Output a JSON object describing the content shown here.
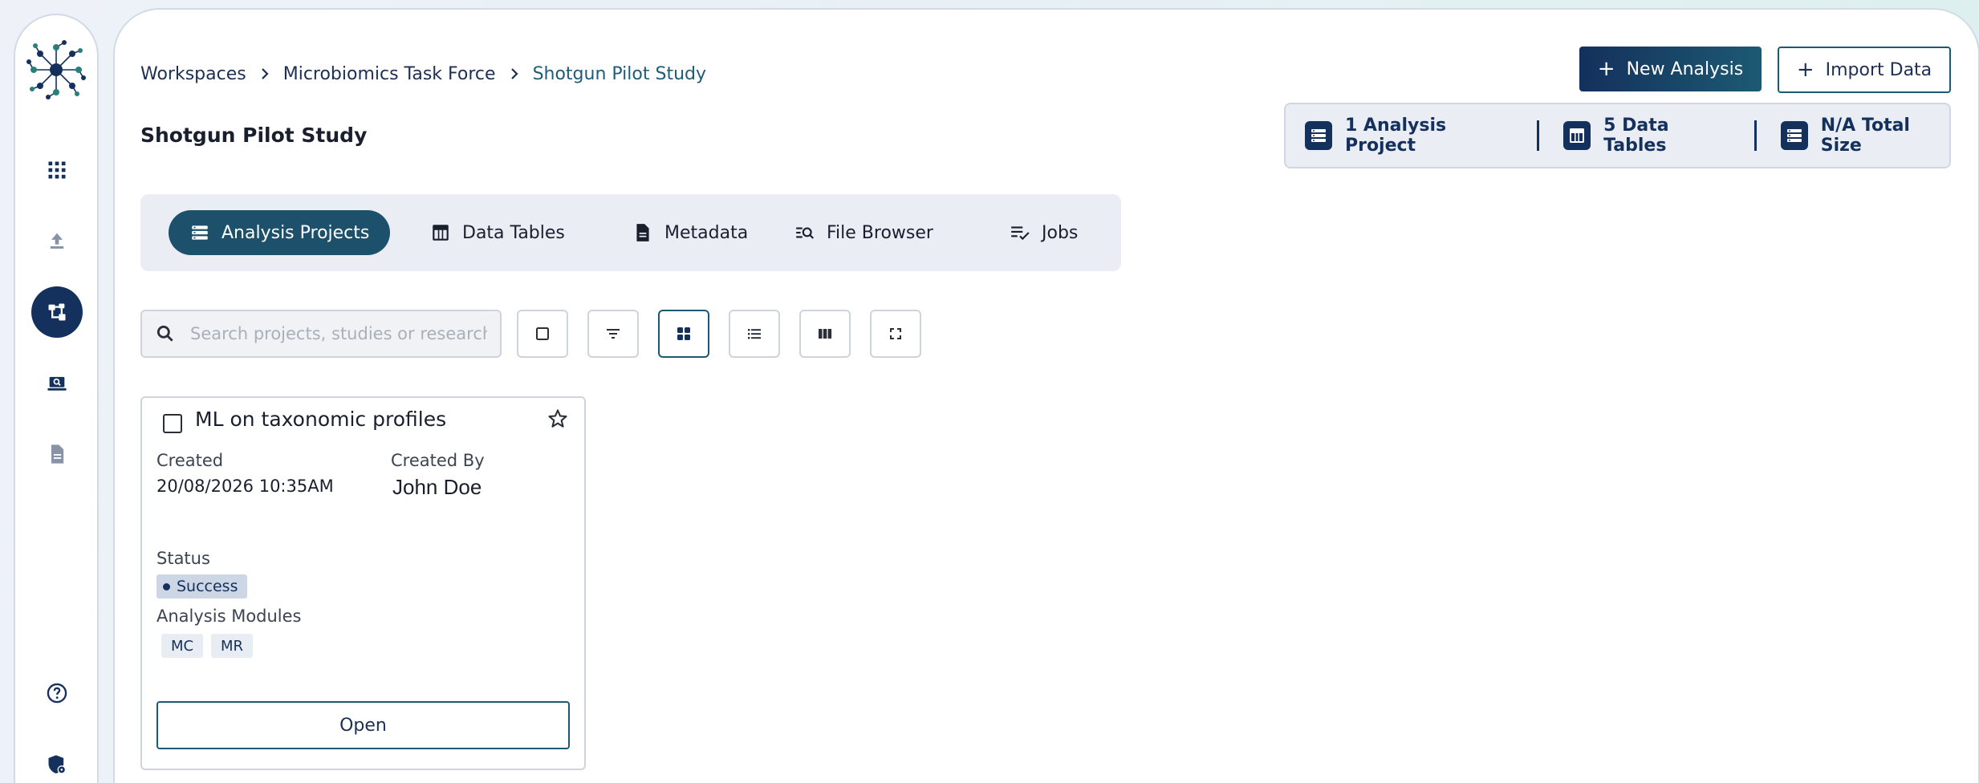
{
  "breadcrumb": {
    "items": [
      {
        "label": "Workspaces"
      },
      {
        "label": "Microbiomics Task Force"
      },
      {
        "label": "Shotgun Pilot Study"
      }
    ]
  },
  "page": {
    "title": "Shotgun Pilot Study"
  },
  "actions": {
    "new_analysis": "New Analysis",
    "import_data": "Import Data",
    "plus_glyph": "+"
  },
  "stats": {
    "projects": "1 Analysis Project",
    "tables": "5 Data Tables",
    "size": "N/A Total Size"
  },
  "tabs": [
    {
      "label": "Analysis Projects",
      "icon": "list-icon",
      "active": true
    },
    {
      "label": "Data Tables",
      "icon": "table-icon",
      "active": false
    },
    {
      "label": "Metadata",
      "icon": "document-icon",
      "active": false
    },
    {
      "label": "File Browser",
      "icon": "file-search-icon",
      "active": false
    },
    {
      "label": "Jobs",
      "icon": "checklist-icon",
      "active": false
    }
  ],
  "search": {
    "placeholder": "Search projects, studies or research",
    "value": ""
  },
  "toolbar": [
    "select-all-icon",
    "filter-icon",
    "grid-view-icon",
    "list-view-icon",
    "column-view-icon",
    "fullscreen-icon"
  ],
  "sidebar": [
    "apps-grid-icon",
    "upload-icon",
    "workflow-icon",
    "laptop-search-icon",
    "document-icon",
    "help-icon",
    "security-icon"
  ],
  "card": {
    "title": "ML on taxonomic profiles",
    "created_label": "Created",
    "created_value": "20/08/2026 10:35AM",
    "created_by_label": "Created By",
    "created_by_value": "John Doe",
    "status_label": "Status",
    "status_value": "Success",
    "modules_label": "Analysis Modules",
    "modules": [
      "MC",
      "MR"
    ],
    "open_label": "Open"
  },
  "colors": {
    "brand_navy": "#14305c",
    "brand_teal": "#1c5a73",
    "tab_active": "#1d506b",
    "panel_bg": "#eaeef4"
  }
}
